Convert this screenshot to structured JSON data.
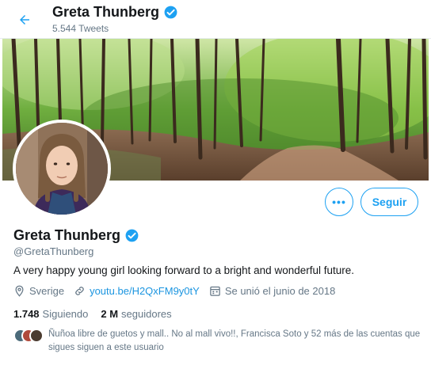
{
  "header": {
    "name": "Greta Thunberg",
    "tweet_count": "5.544 Tweets"
  },
  "profile": {
    "name": "Greta Thunberg",
    "handle": "@GretaThunberg",
    "bio": "A very happy young girl looking forward to a bright and wonderful future.",
    "location": "Sverige",
    "link": "youtu.be/H2QxFM9y0tY",
    "joined": "Se unió el junio de 2018",
    "following_count": "1.748",
    "following_label": "Siguiendo",
    "followers_count": "2 M",
    "followers_label": "seguidores",
    "followers_you_know": "Ñuñoa libre de guetos y mall.. No al mall vivo!!, Francisca Soto y 52 más de las cuentas que sigues siguen a este usuario"
  },
  "actions": {
    "more_label": "•••",
    "follow_label": "Seguir"
  },
  "colors": {
    "accent": "#1da1f2",
    "link": "#1b95e0",
    "muted": "#657786",
    "verified": "#1da1f2"
  },
  "icons": [
    "back-arrow-icon",
    "verified-badge-icon",
    "location-pin-icon",
    "link-icon",
    "calendar-icon"
  ]
}
